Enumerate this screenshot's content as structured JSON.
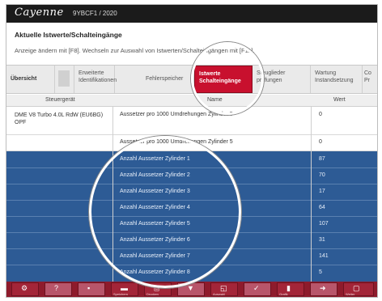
{
  "app": {
    "brand": "Cayenne",
    "vin_info": "9YBCF1 / 2020"
  },
  "page": {
    "title": "Aktuelle Istwerte/Schalteingänge",
    "hint": "Anzeige ändern mit [F8]. Wechseln zur Auswahl von Istwerten/Schalteingängen mit [F11]."
  },
  "tabs": [
    {
      "label": "Übersicht",
      "line2": ""
    },
    {
      "label": "",
      "line2": ""
    },
    {
      "label": "Erweiterte",
      "line2": "Identifikationen"
    },
    {
      "label": "Fehlerspeicher",
      "line2": ""
    },
    {
      "label": "Istwerte",
      "line2": "Schalteingänge"
    },
    {
      "label": "Steuglieder",
      "line2": "prüfungen"
    },
    {
      "label": "Wartung",
      "line2": "Instandsetzung"
    },
    {
      "label": "Co",
      "line2": "Pr"
    }
  ],
  "table": {
    "headers": [
      "Steuergerät",
      "Name",
      "Wert"
    ],
    "white_rows": [
      {
        "device": "DME V8 Turbo 4.0L RdW (EU6BG) OPF",
        "name": "Aussetzer pro 1000 Umdrehungen Zylinder 5",
        "value": "0"
      },
      {
        "device": "",
        "name": "Aussetzer pro 1000 Umdrehungen Zylinder 5",
        "value": "0"
      }
    ],
    "blue_rows": [
      {
        "name": "Anzahl Aussetzer Zylinder 1",
        "value": "87"
      },
      {
        "name": "Anzahl Aussetzer Zylinder 2",
        "value": "70"
      },
      {
        "name": "Anzahl Aussetzer Zylinder 3",
        "value": "17"
      },
      {
        "name": "Anzahl Aussetzer Zylinder 4",
        "value": "64"
      },
      {
        "name": "Anzahl Aussetzer Zylinder 5",
        "value": "107"
      },
      {
        "name": "Anzahl Aussetzer Zylinder 6",
        "value": "31"
      },
      {
        "name": "Anzahl Aussetzer Zylinder 7",
        "value": "141"
      },
      {
        "name": "Anzahl Aussetzer Zylinder 8",
        "value": "5"
      }
    ]
  },
  "bottom_buttons": [
    {
      "icon": "gear-icon",
      "glyph": "⚙",
      "label": ""
    },
    {
      "icon": "help-icon",
      "glyph": "?",
      "label": ""
    },
    {
      "icon": "message-icon",
      "glyph": "▪",
      "label": ""
    },
    {
      "icon": "save-icon",
      "glyph": "▬",
      "label": "Speichern"
    },
    {
      "icon": "print-icon",
      "glyph": "⎙",
      "label": "Drucken"
    },
    {
      "icon": "filter-icon",
      "glyph": "▼",
      "label": ""
    },
    {
      "icon": "measure-icon",
      "glyph": "◱",
      "label": "Auswahl"
    },
    {
      "icon": "check-icon",
      "glyph": "✓",
      "label": ""
    },
    {
      "icon": "chart-icon",
      "glyph": "▮",
      "label": "Grafik"
    },
    {
      "icon": "forward-icon",
      "glyph": "➜",
      "label": ""
    },
    {
      "icon": "page-icon",
      "glyph": "▢",
      "label": "Weiter"
    }
  ],
  "colors": {
    "accent": "#c8102e",
    "selection": "#2d5b95",
    "titlebar": "#1b1b1b",
    "bottombar": "#8e1b2c"
  }
}
